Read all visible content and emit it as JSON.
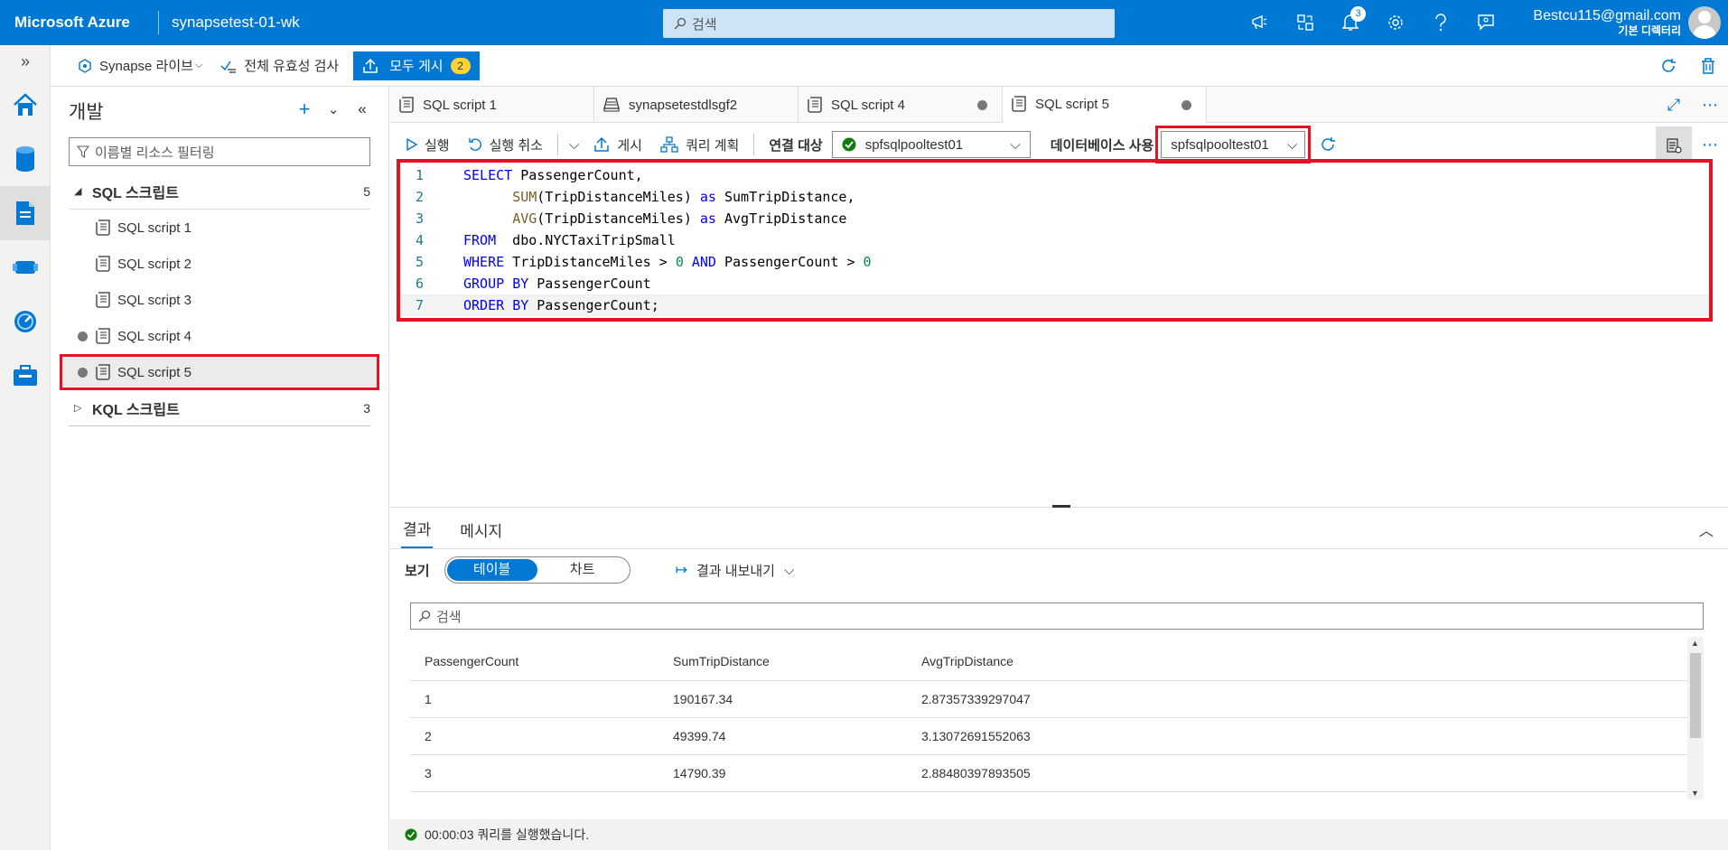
{
  "topbar": {
    "brand": "Microsoft Azure",
    "workspace": "synapsetest-01-wk",
    "search_placeholder": "검색",
    "notification_count": "3",
    "account_email": "Bestcu115@gmail.com",
    "account_directory": "기본 디렉터리"
  },
  "subbar": {
    "live": "Synapse 라이브",
    "validate_all": "전체 유효성 검사",
    "publish_all": "모두 게시",
    "publish_count": "2"
  },
  "explorer": {
    "title": "개발",
    "filter_placeholder": "이름별 리소스 필터링",
    "sql_section": "SQL 스크립트",
    "sql_count": "5",
    "sql_items": [
      "SQL script 1",
      "SQL script 2",
      "SQL script 3",
      "SQL script 4",
      "SQL script 5"
    ],
    "kql_section": "KQL 스크립트",
    "kql_count": "3"
  },
  "tabs": [
    {
      "label": "SQL script 1"
    },
    {
      "label": "synapsetestdlsgf2"
    },
    {
      "label": "SQL script 4"
    },
    {
      "label": "SQL script 5"
    }
  ],
  "editor_toolbar": {
    "run": "실행",
    "undo": "실행 취소",
    "publish": "게시",
    "query_plan": "쿼리 계획",
    "connect_label": "연결 대상",
    "connect_value": "spfsqlpooltest01",
    "db_label": "데이터베이스 사용",
    "db_value": "spfsqlpooltest01"
  },
  "code_lines": [
    "1",
    "2",
    "3",
    "4",
    "5",
    "6",
    "7"
  ],
  "results": {
    "tab_results": "결과",
    "tab_messages": "메시지",
    "view_label": "보기",
    "view_table": "테이블",
    "view_chart": "차트",
    "export": "결과 내보내기",
    "search_placeholder": "검색",
    "columns": [
      "PassengerCount",
      "SumTripDistance",
      "AvgTripDistance"
    ],
    "rows": [
      [
        "1",
        "190167.34",
        "2.87357339297047"
      ],
      [
        "2",
        "49399.74",
        "3.13072691552063"
      ],
      [
        "3",
        "14790.39",
        "2.88480397893505"
      ]
    ]
  },
  "status": {
    "text": "00:00:03 쿼리를 실행했습니다."
  },
  "colors": {
    "azure_blue": "#0078d4",
    "highlight_red": "#e81123"
  }
}
